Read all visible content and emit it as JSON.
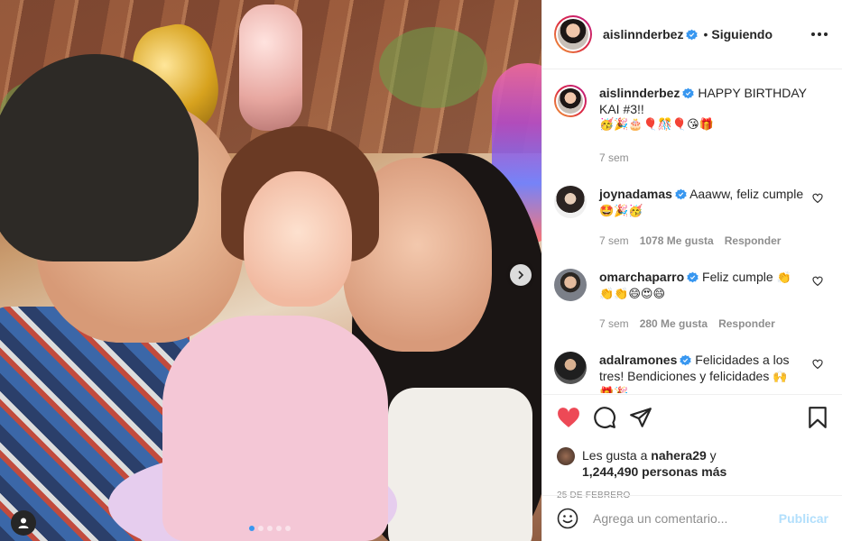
{
  "post": {
    "carousel_dots": 5,
    "active_dot": 0
  },
  "header": {
    "username": "aislinnderbez",
    "separator": "•",
    "follow_status": "Siguiendo",
    "more_icon": "more-horizontal-icon"
  },
  "caption": {
    "username": "aislinnderbez",
    "text": "HAPPY BIRTHDAY KAI #3!!",
    "emojis": "🥳🎉🎂🎈🎊🎈😘🎁",
    "time": "7 sem"
  },
  "comments": [
    {
      "username": "joynadamas",
      "verified": true,
      "text": "Aaaww, feliz cumple",
      "emojis": "🤩🎉🥳",
      "time": "7 sem",
      "likes": "1078 Me gusta",
      "reply": "Responder"
    },
    {
      "username": "omarchaparro",
      "verified": true,
      "text": "Feliz cumple",
      "emojis_inline": "👏",
      "emojis": "👏👏😄😍😄",
      "time": "7 sem",
      "likes": "280 Me gusta",
      "reply": "Responder"
    },
    {
      "username": "adalramones",
      "verified": true,
      "text": "Felicidades a los tres! Bendiciones y felicidades",
      "emojis_inline": "🙌",
      "emojis": "🎁🎉"
    }
  ],
  "likes": {
    "prefix": "Les gusta a",
    "user": "nahera29",
    "conj": "y",
    "others": "1,244,490 personas más"
  },
  "date": "25 DE FEBRERO",
  "add_comment": {
    "placeholder": "Agrega un comentario...",
    "publish": "Publicar"
  },
  "colors": {
    "verified": "#3897f0",
    "liked": "#ed4956",
    "publish_disabled": "#b2dffc"
  }
}
